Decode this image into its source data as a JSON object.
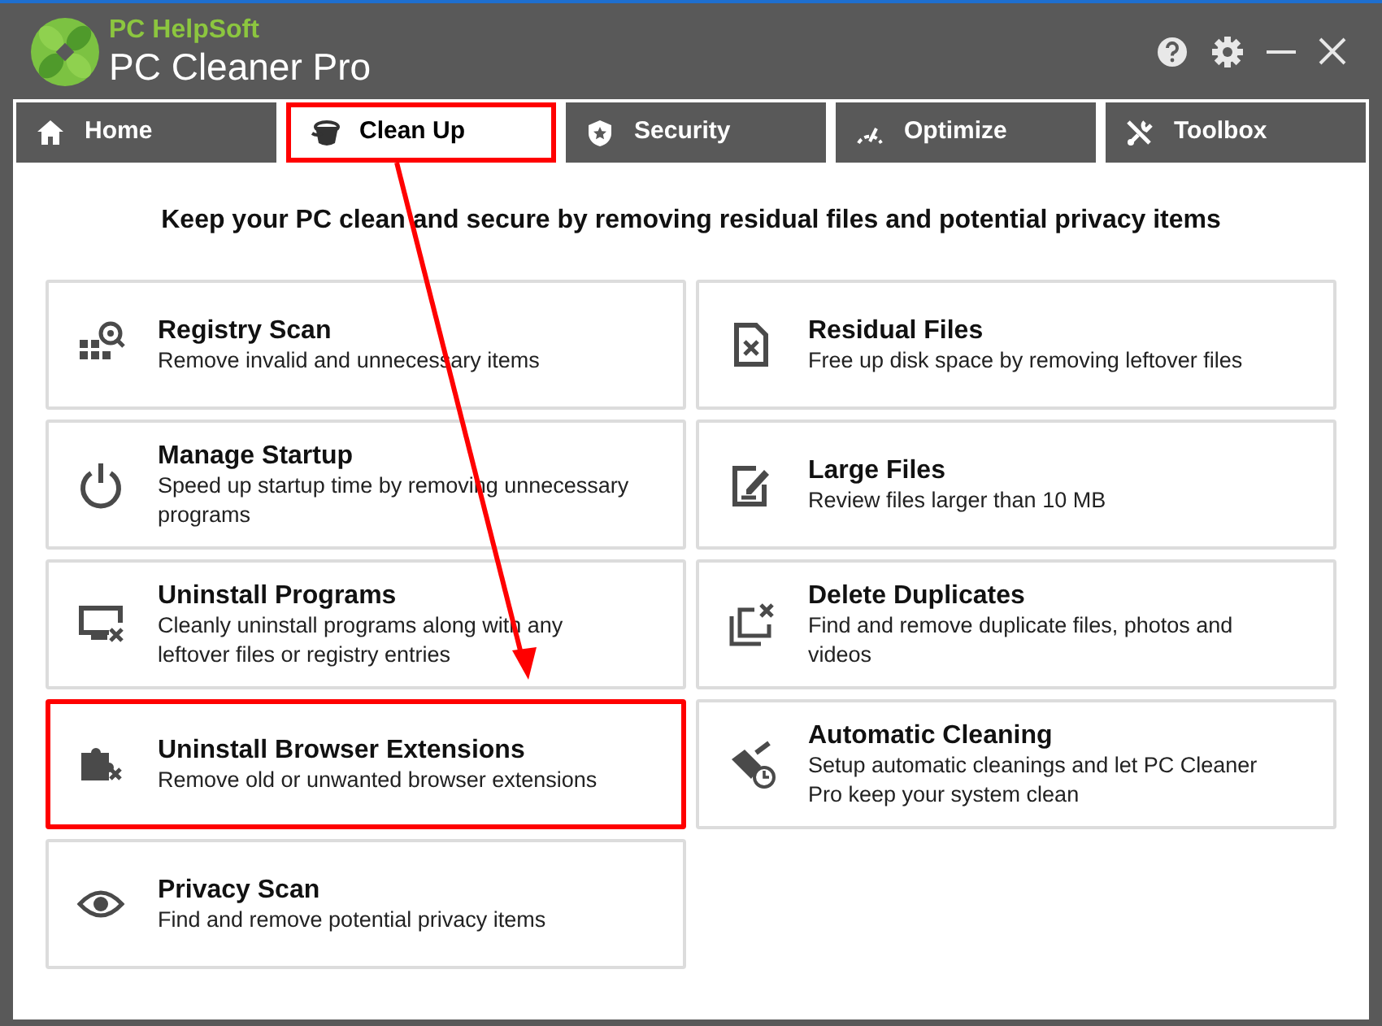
{
  "app": {
    "brand": "PC HelpSoft",
    "title": "PC Cleaner Pro"
  },
  "tabs": [
    {
      "label": "Home",
      "kind": "home",
      "selected": false,
      "highlighted": false
    },
    {
      "label": "Clean Up",
      "kind": "cleanup",
      "selected": true,
      "highlighted": true
    },
    {
      "label": "Security",
      "kind": "security",
      "selected": false,
      "highlighted": false
    },
    {
      "label": "Optimize",
      "kind": "optimize",
      "selected": false,
      "highlighted": false
    },
    {
      "label": "Toolbox",
      "kind": "toolbox",
      "selected": false,
      "highlighted": false
    }
  ],
  "heading": "Keep your PC clean and secure by removing residual files and potential privacy items",
  "left_cards": [
    {
      "kind": "registry",
      "title": "Registry Scan",
      "description": "Remove invalid and unnecessary items",
      "highlighted": false
    },
    {
      "kind": "startup",
      "title": "Manage Startup",
      "description": "Speed up startup time by removing unnecessary programs",
      "highlighted": false
    },
    {
      "kind": "uninstall",
      "title": "Uninstall Programs",
      "description": "Cleanly uninstall programs along with any leftover files or registry entries",
      "highlighted": false
    },
    {
      "kind": "extensions",
      "title": "Uninstall Browser Extensions",
      "description": "Remove old or unwanted browser extensions",
      "highlighted": true
    },
    {
      "kind": "privacy",
      "title": "Privacy Scan",
      "description": "Find and remove potential privacy items",
      "highlighted": false
    }
  ],
  "right_cards": [
    {
      "kind": "residual",
      "title": "Residual Files",
      "description": "Free up disk space by removing leftover files",
      "highlighted": false
    },
    {
      "kind": "large",
      "title": "Large Files",
      "description": "Review files larger than 10 MB",
      "highlighted": false
    },
    {
      "kind": "duplicates",
      "title": "Delete Duplicates",
      "description": "Find and remove duplicate files, photos and videos",
      "highlighted": false
    },
    {
      "kind": "auto",
      "title": "Automatic Cleaning",
      "description": "Setup automatic cleanings and let PC Cleaner Pro keep your system clean",
      "highlighted": false
    }
  ]
}
